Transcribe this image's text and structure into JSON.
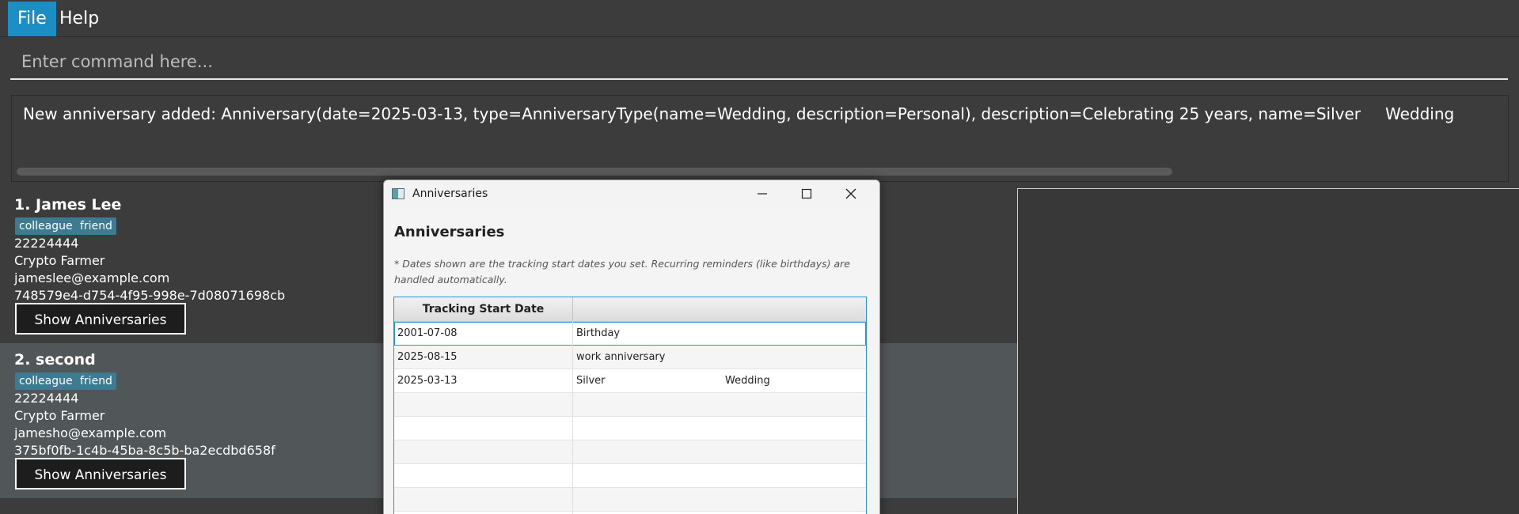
{
  "menu": {
    "file": "File",
    "help": "Help"
  },
  "command": {
    "placeholder": "Enter command here..."
  },
  "result": {
    "text": "New anniversary added: Anniversary(date=2025-03-13, type=AnniversaryType(name=Wedding, description=Personal), description=Celebrating 25 years, name=Silver",
    "extra": "Wedding"
  },
  "persons": [
    {
      "name": "1. James Lee",
      "tags": [
        "colleague",
        "friend"
      ],
      "phone": "22224444",
      "address": "Crypto Farmer",
      "email": "jameslee@example.com",
      "id": "748579e4-d754-4f95-998e-7d08071698cb",
      "button": "Show Anniversaries"
    },
    {
      "name": "2. second",
      "tags": [
        "colleague",
        "friend"
      ],
      "phone": "22224444",
      "address": "Crypto Farmer",
      "email": "jamesho@example.com",
      "id": "375bf0fb-1c4b-45ba-8c5b-ba2ecdbd658f",
      "button": "Show Anniversaries"
    }
  ],
  "dialog": {
    "title": "Anniversaries",
    "heading": "Anniversaries",
    "note": "* Dates shown are the tracking start dates you set. Recurring reminders (like birthdays) are handled automatically.",
    "columns": [
      "Tracking Start Date",
      ""
    ],
    "rows": [
      {
        "date": "2001-07-08",
        "name": "Birthday",
        "type": ""
      },
      {
        "date": "2025-08-15",
        "name": "work anniversary",
        "type": ""
      },
      {
        "date": "2025-03-13",
        "name": "Silver",
        "type": "Wedding"
      }
    ]
  }
}
